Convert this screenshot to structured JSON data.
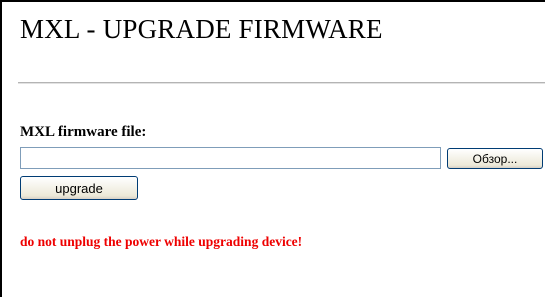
{
  "page": {
    "title": "MXL - UPGRADE FIRMWARE"
  },
  "form": {
    "file_label": "MXL firmware file:",
    "file_value": "",
    "browse_label": "Обзор...",
    "upgrade_label": "upgrade"
  },
  "warning": {
    "text": "do not unplug the power while upgrading device!",
    "color": "#ee0000"
  }
}
